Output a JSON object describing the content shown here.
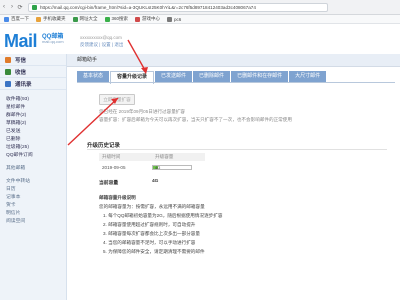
{
  "browser": {
    "back_icon": "arrow-left",
    "url": "https://mail.qq.com/cgi-bin/frame_html?sid=a-3QUKLsI25K0hYiL&r=2c76f5d89718412403ad3c408067a74",
    "bookmarks": [
      "百度一下",
      "手机收藏夹",
      "网址大全",
      "360搜索",
      "游戏中心",
      "pc6"
    ]
  },
  "header": {
    "logo_text": "Mail",
    "logo_cn": "QQ邮箱",
    "logo_sub": "mail.qq.com",
    "user_line": "xxxxxxxxxx@qq.com",
    "user_links": "反馈建议 | 设置 | 退出"
  },
  "sidebar": {
    "buttons": [
      {
        "label": "写信",
        "color": "#e07b2a"
      },
      {
        "label": "收信",
        "color": "#3a8a3a"
      },
      {
        "label": "通讯录",
        "color": "#3b74c4"
      }
    ],
    "items": [
      "收件箱(93)",
      "星标邮件",
      "群邮件(2)",
      "草稿箱(2)",
      "已发送",
      "已删除",
      "垃圾箱(25)",
      "QQ邮件订阅",
      "",
      "其他邮箱",
      "",
      "文件中转站",
      "日历",
      "记事本",
      "贺卡",
      "明信片",
      "阅读空间"
    ]
  },
  "main": {
    "crumb": "邮箱助手",
    "tabs": [
      {
        "label": "基本状态",
        "active": false
      },
      {
        "label": "容量升级记录",
        "active": true
      },
      {
        "label": "已发送邮件",
        "active": false
      },
      {
        "label": "已删除邮件",
        "active": false
      },
      {
        "label": "已删邮件和在存邮件",
        "active": false
      },
      {
        "label": "大尺寸邮件",
        "active": false
      }
    ],
    "upgrade_button": "立即容量扩容",
    "note1": "您已经在 2019年09月05日进行过容量扩容",
    "note2": "容量扩容：扩容后邮箱为今天可以再次扩容，当天只扩容不了一次，也不会影响邮件的正常使用",
    "section_title": "升级历史记录",
    "table_headers": [
      "升级时间",
      "升级容量"
    ],
    "rows": [
      {
        "date": "2019-09-05",
        "amount": "4G",
        "fill": 0.12
      }
    ],
    "total_label": "当前容量",
    "total_value": "4G",
    "rules_title": "邮箱容量升级说明",
    "rules_intro": "您的邮箱容量为：按需扩容，永远用不满的邮箱容量",
    "rules": [
      "1. 每个QQ邮箱初始容量为2G，随后根据使用情况逐步扩容",
      "2. 邮箱容量使用超过扩容规则时，可自动提升",
      "3. 邮箱容量每次扩容都会比上次多出一部分容量",
      "4. 当您的邮箱容量不足时，可以手动进行扩容",
      "5. 为保障您的邮件安全，请定期清理不需要的邮件"
    ]
  }
}
